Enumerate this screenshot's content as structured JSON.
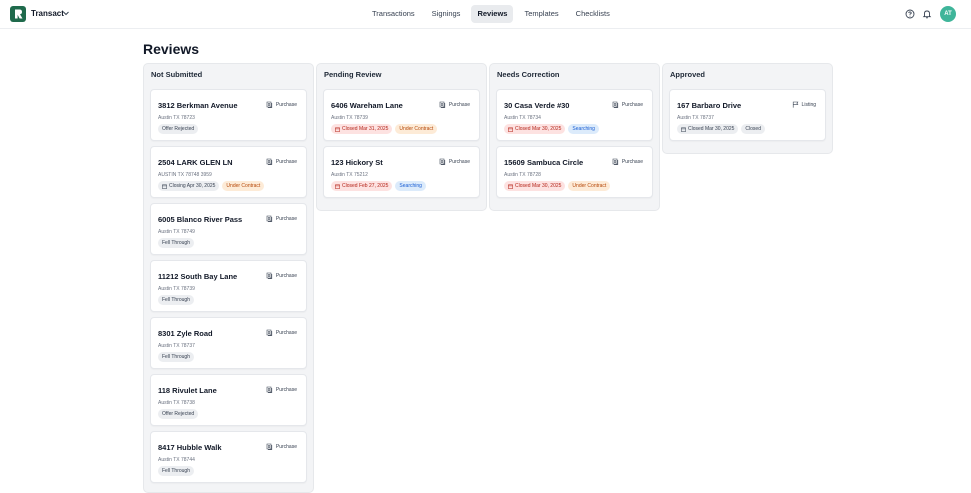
{
  "app": {
    "name": "Transact"
  },
  "nav": {
    "tabs": [
      {
        "label": "Transactions",
        "active": false
      },
      {
        "label": "Signings",
        "active": false
      },
      {
        "label": "Reviews",
        "active": true
      },
      {
        "label": "Templates",
        "active": false
      },
      {
        "label": "Checklists",
        "active": false
      }
    ],
    "avatar_initials": "AT"
  },
  "page": {
    "title": "Reviews"
  },
  "columns": [
    {
      "title": "Not Submitted",
      "cards": [
        {
          "address": "3812 Berkman Avenue",
          "city": "Austin TX 78723",
          "type": "Purchase",
          "type_icon": "document-stack-icon",
          "badges": [
            {
              "text": "Offer Rejected",
              "style": "gray"
            }
          ]
        },
        {
          "address": "2504 LARK GLEN LN",
          "city": "AUSTIN TX 78748 3959",
          "type": "Purchase",
          "type_icon": "document-stack-icon",
          "badges": [
            {
              "text": "Closing Apr 30, 2025",
              "style": "gray",
              "icon": "calendar-icon"
            },
            {
              "text": "Under Contract",
              "style": "orange"
            }
          ]
        },
        {
          "address": "6005 Blanco River Pass",
          "city": "Austin TX 78749",
          "type": "Purchase",
          "type_icon": "document-stack-icon",
          "badges": [
            {
              "text": "Fell Through",
              "style": "gray"
            }
          ]
        },
        {
          "address": "11212 South Bay Lane",
          "city": "Austin TX 78739",
          "type": "Purchase",
          "type_icon": "document-stack-icon",
          "badges": [
            {
              "text": "Fell Through",
              "style": "gray"
            }
          ]
        },
        {
          "address": "8301 Zyle Road",
          "city": "Austin TX 78737",
          "type": "Purchase",
          "type_icon": "document-stack-icon",
          "badges": [
            {
              "text": "Fell Through",
              "style": "gray"
            }
          ]
        },
        {
          "address": "118 Rivulet Lane",
          "city": "Austin TX 78738",
          "type": "Purchase",
          "type_icon": "document-stack-icon",
          "badges": [
            {
              "text": "Offer Rejected",
              "style": "gray"
            }
          ]
        },
        {
          "address": "8417 Hubble Walk",
          "city": "Austin TX 78744",
          "type": "Purchase",
          "type_icon": "document-stack-icon",
          "badges": [
            {
              "text": "Fell Through",
              "style": "gray"
            }
          ]
        }
      ]
    },
    {
      "title": "Pending Review",
      "cards": [
        {
          "address": "6406 Wareham Lane",
          "city": "Austin TX 78739",
          "type": "Purchase",
          "type_icon": "document-stack-icon",
          "badges": [
            {
              "text": "Closed Mar 31, 2025",
              "style": "red",
              "icon": "calendar-icon"
            },
            {
              "text": "Under Contract",
              "style": "orange"
            }
          ]
        },
        {
          "address": "123 Hickory St",
          "city": "Austin TX 75212",
          "type": "Purchase",
          "type_icon": "document-stack-icon",
          "badges": [
            {
              "text": "Closed Feb 27, 2025",
              "style": "red",
              "icon": "calendar-icon"
            },
            {
              "text": "Searching",
              "style": "blue"
            }
          ]
        }
      ]
    },
    {
      "title": "Needs Correction",
      "cards": [
        {
          "address": "30 Casa Verde #30",
          "city": "Austin TX 78734",
          "type": "Purchase",
          "type_icon": "document-stack-icon",
          "badges": [
            {
              "text": "Closed Mar 30, 2025",
              "style": "red",
              "icon": "calendar-icon"
            },
            {
              "text": "Searching",
              "style": "blue"
            }
          ]
        },
        {
          "address": "15609 Sambuca Circle",
          "city": "Austin TX 78728",
          "type": "Purchase",
          "type_icon": "document-stack-icon",
          "badges": [
            {
              "text": "Closed Mar 30, 2025",
              "style": "red",
              "icon": "calendar-icon"
            },
            {
              "text": "Under Contract",
              "style": "orange"
            }
          ]
        }
      ]
    },
    {
      "title": "Approved",
      "cards": [
        {
          "address": "167 Barbaro Drive",
          "city": "Austin TX 78737",
          "type": "Listing",
          "type_icon": "signpost-icon",
          "badges": [
            {
              "text": "Closed Mar 30, 2025",
              "style": "gray",
              "icon": "calendar-icon"
            },
            {
              "text": "Closed",
              "style": "gray"
            }
          ]
        }
      ]
    }
  ],
  "colors": {
    "brand": "#1f6a4c",
    "avatar": "#3fb59a",
    "column_bg": "#f3f4f6",
    "badge_gray": "#eceef1",
    "badge_red": "#fde2e1",
    "badge_orange": "#fdebd7",
    "badge_blue": "#dcebfb"
  }
}
